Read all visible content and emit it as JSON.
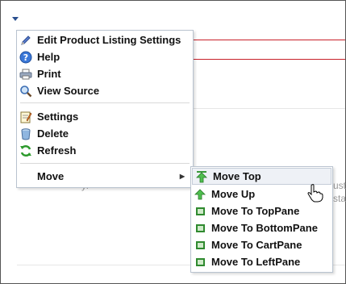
{
  "menu": {
    "items": [
      {
        "label": "Edit Product Listing Settings",
        "icon": "pencil-icon"
      },
      {
        "label": "Help",
        "icon": "help-icon"
      },
      {
        "label": "Print",
        "icon": "printer-icon"
      },
      {
        "label": "View Source",
        "icon": "magnifier-icon"
      },
      {
        "label": "Settings",
        "icon": "settings-notepad-icon"
      },
      {
        "label": "Delete",
        "icon": "trash-icon"
      },
      {
        "label": "Refresh",
        "icon": "refresh-icon"
      },
      {
        "label": "Move",
        "icon": ""
      }
    ]
  },
  "submenu": {
    "items": [
      {
        "label": "Move Top",
        "icon": "arrow-up-icon"
      },
      {
        "label": "Move Up",
        "icon": "arrow-up-icon"
      },
      {
        "label": "Move To TopPane",
        "icon": "pane-icon"
      },
      {
        "label": "Move To BottomPane",
        "icon": "pane-icon"
      },
      {
        "label": "Move To CartPane",
        "icon": "pane-icon"
      },
      {
        "label": "Move To LeftPane",
        "icon": "pane-icon"
      }
    ]
  },
  "background": {
    "fragment_1": "l",
    "fragment_2": "ustu",
    "fragment_3": "sta",
    "fragment_4": "yi"
  }
}
